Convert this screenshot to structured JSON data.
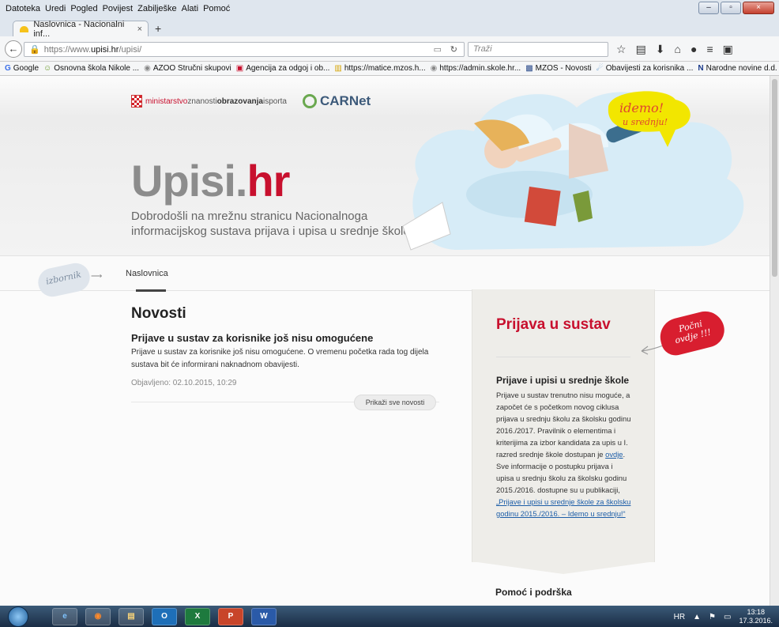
{
  "browser": {
    "menu": [
      "Datoteka",
      "Uredi",
      "Pogled",
      "Povijest",
      "Zabilješke",
      "Alati",
      "Pomoć"
    ],
    "tab_title": "Naslovnica - Nacionalni inf...",
    "tab_close": "×",
    "new_tab": "+",
    "url_prefix": "https://www.",
    "url_host": "upisi.hr",
    "url_path": "/upisi/",
    "search_placeholder": "Traži",
    "bookmarks": [
      {
        "label": "Google",
        "icon": "G"
      },
      {
        "label": "Osnovna škola Nikole ...",
        "icon": "☺"
      },
      {
        "label": "AZOO Stručni skupovi",
        "icon": "◉"
      },
      {
        "label": "Agencija za odgoj i ob...",
        "icon": "▣"
      },
      {
        "label": "https://matice.mzos.h...",
        "icon": "▥"
      },
      {
        "label": "https://admin.skole.hr...",
        "icon": "◉"
      },
      {
        "label": "MZOS - Novosti",
        "icon": "▩"
      },
      {
        "label": "Obavijesti za korisnika ...",
        "icon": "☄"
      },
      {
        "label": "Narodne novine d.d.",
        "icon": "N"
      }
    ]
  },
  "header": {
    "ministry_pre": "ministarstvo",
    "ministry_mid": "znanosti",
    "ministry_bold": "obrazovanja",
    "ministry_post": "isporta",
    "carnet": "CARNet",
    "brand_gray": "Upisi.",
    "brand_red": "hr",
    "welcome": "Dobrodošli na mrežnu stranicu Nacionalnoga informacijskog sustava prijava i upisa u srednje škole.",
    "bubble_top": "idemo!",
    "bubble_bottom": "u srednju!"
  },
  "nav": {
    "izbornik": "izbornik",
    "crumb": "Naslovnica"
  },
  "news": {
    "heading": "Novosti",
    "title": "Prijave u sustav za korisnike još nisu omogućene",
    "text": "Prijave u sustav za korisnike još nisu omogućene. O vremenu početka rada tog dijela sustava bit će informirani naknadnom obavijesti.",
    "meta": "Objavljeno: 02.10.2015, 10:29",
    "show_all": "Prikaži sve novosti"
  },
  "sidebar": {
    "title": "Prijava u sustav",
    "pocni_top": "Počni",
    "pocni_bottom": "ovdje !!!",
    "subheading": "Prijave i upisi u srednje škole",
    "p1": "Prijave u sustav trenutno nisu moguće, a započet će s početkom novog ciklusa prijava u srednju školu za školsku godinu 2016./2017. Pravilnik o elementima i kriterijima za izbor kandidata za upis u I. razred srednje škole dostupan je ",
    "link1": "ovdje",
    "p2": ". Sve informacije o postupku prijava i upisa u srednju školu za školsku godinu 2015./2016. dostupne su u publikaciji, ",
    "link2": "„Prijave i upisi u srednje škole za školsku godinu 2015./2016. – Idemo u srednju!“",
    "help": "Pomoć i podrška"
  },
  "taskbar": {
    "apps": [
      "e",
      "◉",
      "▤",
      "O",
      "X",
      "P",
      "W"
    ],
    "lang": "HR",
    "time": "13:18",
    "date": "17.3.2016."
  }
}
